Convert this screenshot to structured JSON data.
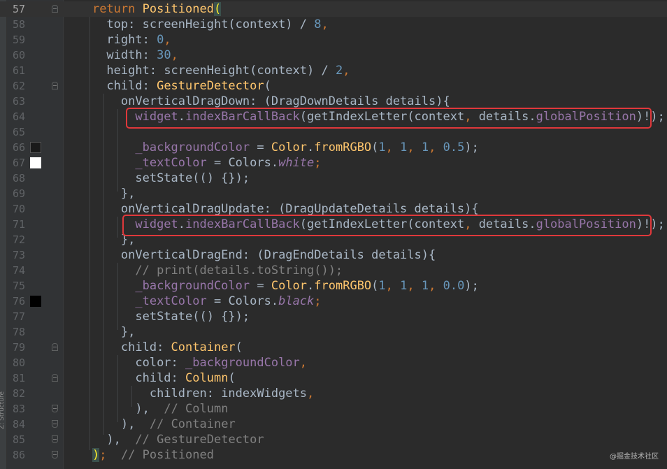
{
  "editor": {
    "side_panel_label": "Z: Structure",
    "watermark": "@掘金技术社区",
    "colors": {
      "swatch_66": "#1a1a1a",
      "swatch_67": "#ffffff",
      "swatch_76": "#000000",
      "highlight_box": "#e0383b"
    }
  },
  "lines": [
    {
      "n": "57"
    },
    {
      "n": "58"
    },
    {
      "n": "59"
    },
    {
      "n": "60"
    },
    {
      "n": "61"
    },
    {
      "n": "62"
    },
    {
      "n": "63"
    },
    {
      "n": "64"
    },
    {
      "n": "65"
    },
    {
      "n": "66"
    },
    {
      "n": "67"
    },
    {
      "n": "68"
    },
    {
      "n": "69"
    },
    {
      "n": "70"
    },
    {
      "n": "71"
    },
    {
      "n": "72"
    },
    {
      "n": "73"
    },
    {
      "n": "74"
    },
    {
      "n": "75"
    },
    {
      "n": "76"
    },
    {
      "n": "77"
    },
    {
      "n": "78"
    },
    {
      "n": "79"
    },
    {
      "n": "80"
    },
    {
      "n": "81"
    },
    {
      "n": "82"
    },
    {
      "n": "83"
    },
    {
      "n": "84"
    },
    {
      "n": "85"
    },
    {
      "n": "86"
    }
  ],
  "tokens": {
    "return": "return",
    "Positioned": "Positioned",
    "paren_open": "(",
    "top": "top: ",
    "screenHeight": "screenHeight(context) / ",
    "eight": "8",
    "comma": ",",
    "right": "right: ",
    "zero": "0",
    "width": "width: ",
    "thirty": "30",
    "height": "height: ",
    "two": "2",
    "child": "child: ",
    "GestureDetector": "GestureDetector",
    "onVerticalDragDown": "onVerticalDragDown: ",
    "dragDownSig": "(DragDownDetails details){",
    "widget": "widget",
    "dot": ".",
    "indexBarCallBack": "indexBarCallBack",
    "getIndexLetterOpen": "(getIndexLetter(context",
    "details_sp": " details.",
    "globalPosition": "globalPosition",
    "callTail": ")!);",
    "backgroundColor": "_backgroundColor",
    "eq": " = ",
    "Color": "Color",
    "fromRGBO": "fromRGBO",
    "one": "1",
    "half": "0.5",
    "zerozero": "0.0",
    "closeSemi": ");",
    "textColor": "_textColor",
    "Colors": "Colors.",
    "white": "white",
    "black": "black",
    "semi": ";",
    "setState": "setState(() {});",
    "closeBraceComma": "},",
    "onVerticalDragUpdate": "onVerticalDragUpdate: ",
    "dragUpdateSig": "(DragUpdateDetails details){",
    "onVerticalDragEnd": "onVerticalDragEnd: ",
    "dragEndSig": "(DragEndDetails details){",
    "printComment": "// print(details.toString());",
    "Container": "Container",
    "color": "color: ",
    "Column": "Column",
    "children": "children: ",
    "indexWidgets": "indexWidgets",
    "closeParenComma": "),",
    "cmColumn": "// Column",
    "cmContainer": "// Container",
    "cmGesture": "// GestureDetector",
    "closeParen": ")",
    "cmPositioned": "// Positioned"
  }
}
